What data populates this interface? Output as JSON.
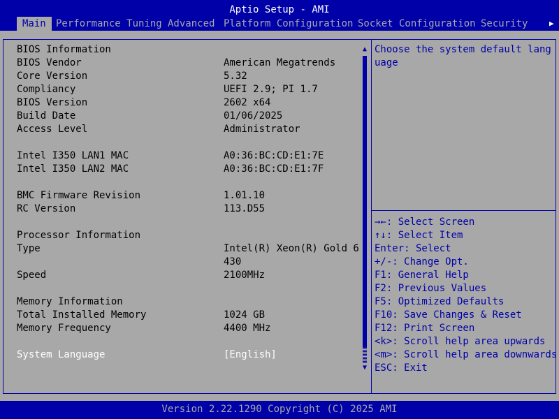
{
  "app_title": "Aptio Setup - AMI",
  "tabs": [
    {
      "label": "Main"
    },
    {
      "label": "Performance Tuning"
    },
    {
      "label": "Advanced"
    },
    {
      "label": "Platform Configuration"
    },
    {
      "label": "Socket Configuration"
    },
    {
      "label": "Security"
    }
  ],
  "active_tab": "Main",
  "tab_scroll_icon": "right-arrow-icon",
  "rows": {
    "bios_info": {
      "label": "BIOS Information"
    },
    "bios_vendor": {
      "label": "BIOS Vendor",
      "value": "American Megatrends"
    },
    "core_version": {
      "label": "Core Version",
      "value": "5.32"
    },
    "compliancy": {
      "label": "Compliancy",
      "value": "UEFI 2.9; PI 1.7"
    },
    "bios_version": {
      "label": "BIOS Version",
      "value": "2602 x64"
    },
    "build_date": {
      "label": "Build Date",
      "value": "01/06/2025"
    },
    "access_level": {
      "label": "Access Level",
      "value": "Administrator"
    },
    "lan1_mac": {
      "label": "Intel I350 LAN1 MAC",
      "value": "A0:36:BC:CD:E1:7E"
    },
    "lan2_mac": {
      "label": "Intel I350 LAN2 MAC",
      "value": "A0:36:BC:CD:E1:7F"
    },
    "bmc_fw": {
      "label": "BMC Firmware Revision",
      "value": "1.01.10"
    },
    "rc_version": {
      "label": "RC Version",
      "value": "113.D55"
    },
    "processor_info": {
      "label": "Processor Information"
    },
    "type": {
      "label": "Type",
      "value_line1": "Intel(R) Xeon(R) Gold 6",
      "value_line2": "430"
    },
    "speed": {
      "label": "Speed",
      "value": "2100MHz"
    },
    "memory_info": {
      "label": "Memory Information"
    },
    "total_memory": {
      "label": "Total Installed Memory",
      "value": "1024 GB"
    },
    "memory_freq": {
      "label": "Memory Frequency",
      "value": "4400 MHz"
    },
    "system_language": {
      "label": "System Language",
      "value": "[English]"
    }
  },
  "help_text": "Choose the system default language",
  "key_help": [
    "→←: Select Screen",
    "↑↓: Select Item",
    "Enter: Select",
    "+/-: Change Opt.",
    "F1: General Help",
    "F2: Previous Values",
    "F5: Optimized Defaults",
    "F10: Save Changes & Reset",
    "F12: Print Screen",
    "<k>: Scroll help area upwards",
    "<m>: Scroll help area downwards",
    "ESC: Exit"
  ],
  "footer": "Version 2.22.1290 Copyright (C) 2025 AMI",
  "colors": {
    "background": "#a8a8a8",
    "accent": "#0000a8",
    "text": "#000000",
    "highlight": "#ffffff"
  }
}
